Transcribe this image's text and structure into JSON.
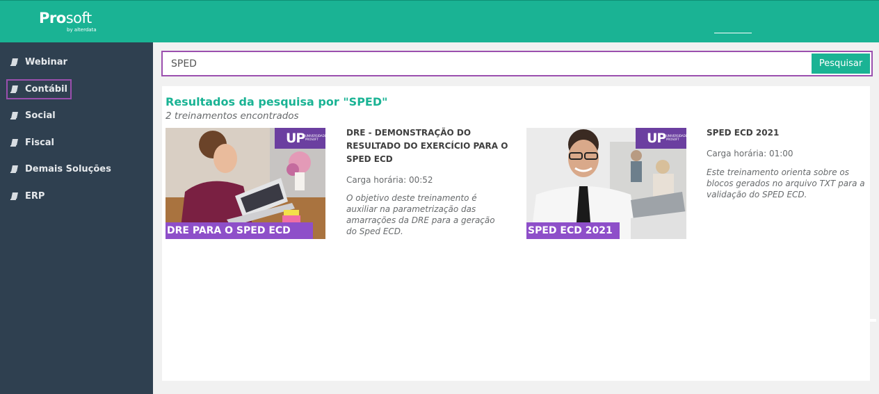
{
  "header": {
    "brand_bold": "Pro",
    "brand_regular": "soft",
    "brand_sub": "by alterdata"
  },
  "sidebar": {
    "items": [
      {
        "label": "Webinar"
      },
      {
        "label": "Contábil",
        "active": true
      },
      {
        "label": "Social"
      },
      {
        "label": "Fiscal"
      },
      {
        "label": "Demais Soluções"
      },
      {
        "label": "ERP"
      }
    ]
  },
  "search": {
    "value": "SPED",
    "button_label": "Pesquisar"
  },
  "results": {
    "title": "Resultados da pesquisa por \"SPED\"",
    "count": "2 treinamentos encontrados",
    "items": [
      {
        "thumbnail_label": "DRE PARA O SPED ECD",
        "thumbnail_badge": "UP",
        "thumbnail_badge_small": "UNIVERSIDADE PROSOFT",
        "title": "DRE - DEMONSTRAÇÃO DO RESULTADO DO EXERCÍCIO PARA O SPED ECD",
        "hours": "Carga horária: 00:52",
        "description": "O objetivo deste treinamento é auxiliar na parametrização das amarrações da DRE para a geração do Sped ECD."
      },
      {
        "thumbnail_label": "SPED ECD 2021",
        "thumbnail_badge": "UP",
        "thumbnail_badge_small": "UNIVERSIDADE PROSOFT",
        "title": "SPED ECD 2021",
        "hours": "Carga horária: 01:00",
        "description": "Este treinamento orienta sobre os blocos gerados no arquivo TXT para a validação do SPED ECD."
      }
    ]
  },
  "colors": {
    "accent": "#1ab394",
    "sidebar": "#2f4050",
    "highlight": "#9b4fae",
    "thumb_label": "#8e4fc9",
    "thumb_badge": "#6b3fa0"
  }
}
